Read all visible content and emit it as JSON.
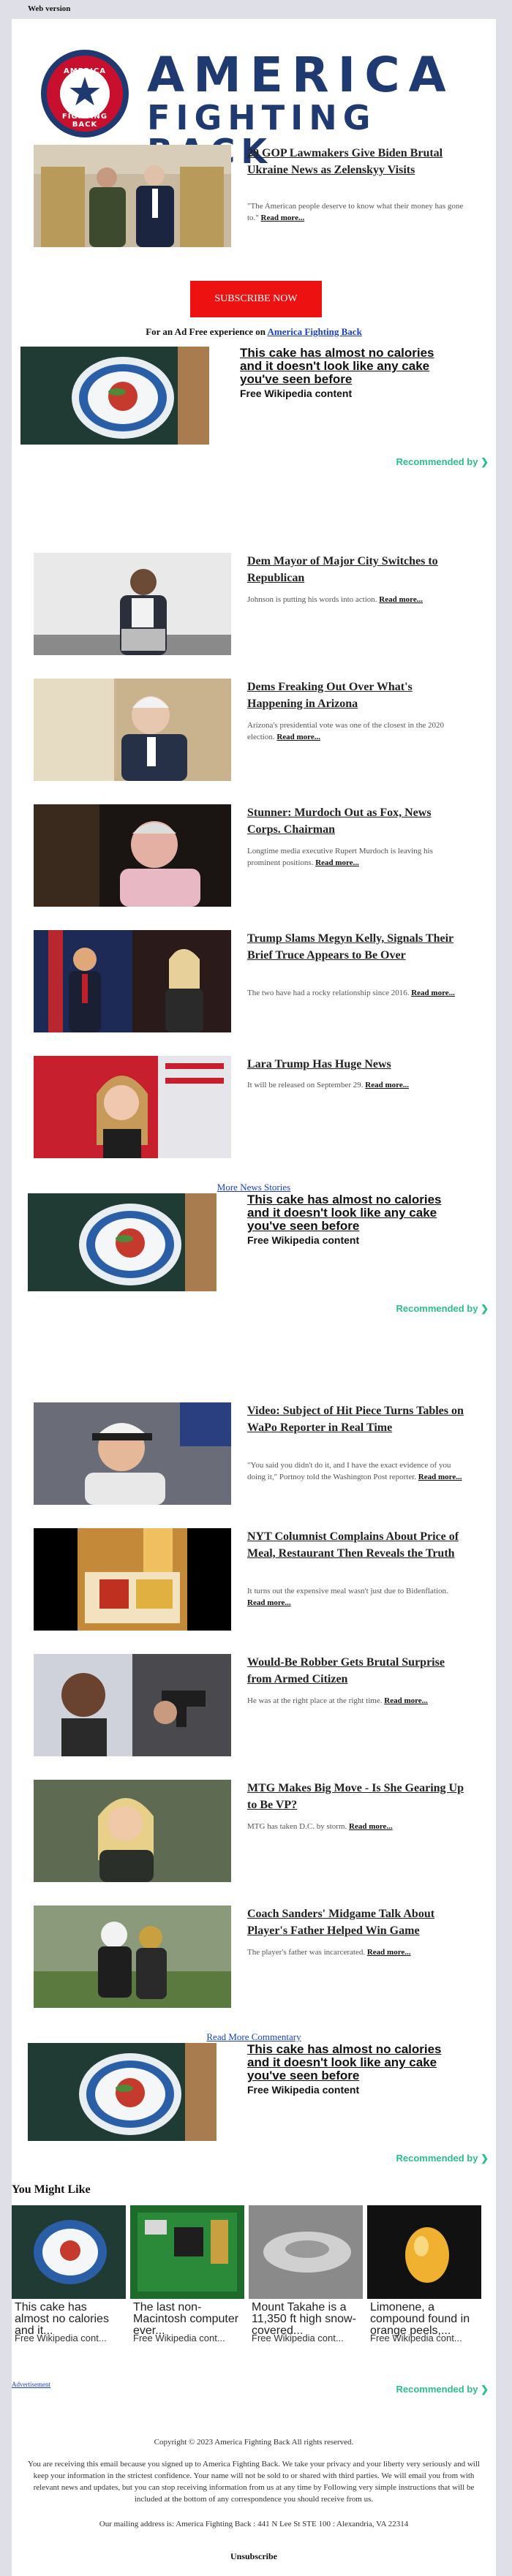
{
  "web_version": "Web version",
  "logo": {
    "line1": "AMERICA",
    "line2": "FIGHTING BACK",
    "arc_top": "AMERICA",
    "arc_bottom": "FIGHTING BACK"
  },
  "top_article": {
    "title": "29 GOP Lawmakers Give Biden Brutal Ukraine News as Zelenskyy Visits",
    "desc": "\"The American people deserve to know what their money has gone to.\"",
    "more": "Read more..."
  },
  "subscribe": "SUBSCRIBE NOW",
  "adfree": {
    "text": "For an Ad Free experience on",
    "link": "America Fighting Back"
  },
  "recommended": {
    "title": "This cake has almost no calories and it doesn't look like any cake you've seen before",
    "source": "Free Wikipedia content",
    "by": "Recommended by"
  },
  "articles_1": [
    {
      "title": "Dem Mayor of Major City Switches to Republican",
      "desc": "Johnson is putting his words into action.",
      "more": "Read more..."
    },
    {
      "title": "Dems Freaking Out Over What's Happening in Arizona",
      "desc": "Arizona's presidential vote was one of the closest in the 2020 election.",
      "more": "Read more..."
    },
    {
      "title": "Stunner: Murdoch Out as Fox, News Corps. Chairman",
      "desc": "Longtime media executive Rupert Murdoch is leaving his prominent positions.",
      "more": "Read more..."
    },
    {
      "title": "Trump Slams Megyn Kelly, Signals Their Brief Truce Appears to Be Over",
      "desc": "The two have had a rocky relationship since 2016.",
      "more": "Read more..."
    },
    {
      "title": "Lara Trump Has Huge News",
      "desc": "It will be released on September 29.",
      "more": "Read more..."
    }
  ],
  "more_news": "More News Stories",
  "articles_2": [
    {
      "title": "Video: Subject of Hit Piece Turns Tables on WaPo Reporter in Real Time",
      "desc": "\"You said you didn't do it, and I have the exact evidence of you doing it,\" Portnoy told the Washington Post reporter.",
      "more": "Read more..."
    },
    {
      "title": "NYT Columnist Complains About Price of Meal, Restaurant Then Reveals the Truth",
      "desc": "It turns out the expensive meal wasn't just due to Bidenflation.",
      "more": "Read more..."
    },
    {
      "title": "Would-Be Robber Gets Brutal Surprise from Armed Citizen",
      "desc": "He was at the right place at the right time.",
      "more": "Read more..."
    },
    {
      "title": "MTG Makes Big Move - Is She Gearing Up to Be VP?",
      "desc": "MTG has taken D.C. by storm.",
      "more": "Read more..."
    },
    {
      "title": "Coach Sanders' Midgame Talk About Player's Father Helped Win Game",
      "desc": "The player's father was incarcerated.",
      "more": "Read more..."
    }
  ],
  "read_more_commentary": "Read More Commentary",
  "you_might_like": "You Might Like",
  "cards": [
    {
      "title": "This cake has almost no calories and it...",
      "source": "Free Wikipedia cont..."
    },
    {
      "title": "The last non-Macintosh computer ever...",
      "source": "Free Wikipedia cont..."
    },
    {
      "title": "Mount Takahe is a 11,350 ft high snow-covered...",
      "source": "Free Wikipedia cont..."
    },
    {
      "title": "Limonene, a compound found in orange peels,...",
      "source": "Free Wikipedia cont..."
    }
  ],
  "advertisement": "Advertisement",
  "footer": {
    "copyright": "Copyright © 2023 America Fighting Back All rights reserved.",
    "notice": "You are receiving this email because you signed up to America Fighting Back. We take your privacy and your liberty very seriously and will keep your information in the strictest confidence. Your name will not be sold to or shared with third parties. We will email you from with relevant news and updates, but you can stop receiving information from us at any time by Following very simple instructions that will be included at the bottom of any correspondence you should receive from us.",
    "address": "Our mailing address is: America Fighting Back : 441 N Lee St STE 100 : Alexandria, VA 22314",
    "unsubscribe": "Unsubscribe"
  }
}
